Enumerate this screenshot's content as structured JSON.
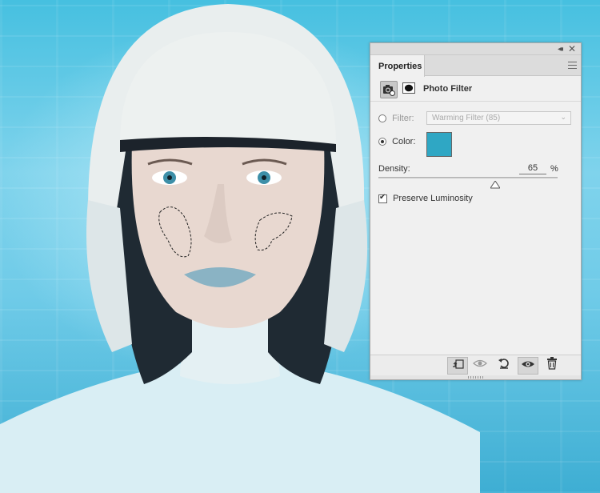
{
  "panel": {
    "tab_label": "Properties",
    "collapse_glyph": "◂◂",
    "close_glyph": "✕",
    "adjustment_title": "Photo Filter",
    "filter": {
      "label": "Filter:",
      "selected_value": "Warming Filter (85)",
      "selected": false
    },
    "color": {
      "label": "Color:",
      "swatch_hex": "#2fa7c4",
      "selected": true
    },
    "density": {
      "label": "Density:",
      "value": "65",
      "unit": "%",
      "fraction": 0.65
    },
    "preserve_luminosity": {
      "label": "Preserve Luminosity",
      "checked": true
    }
  },
  "icons": {
    "camera": "camera-icon",
    "mask": "mask-icon",
    "clip": "clip-to-layer-icon",
    "view_previous": "view-previous-state-icon",
    "reset": "reset-icon",
    "visibility": "eye-icon",
    "delete": "trash-icon"
  }
}
